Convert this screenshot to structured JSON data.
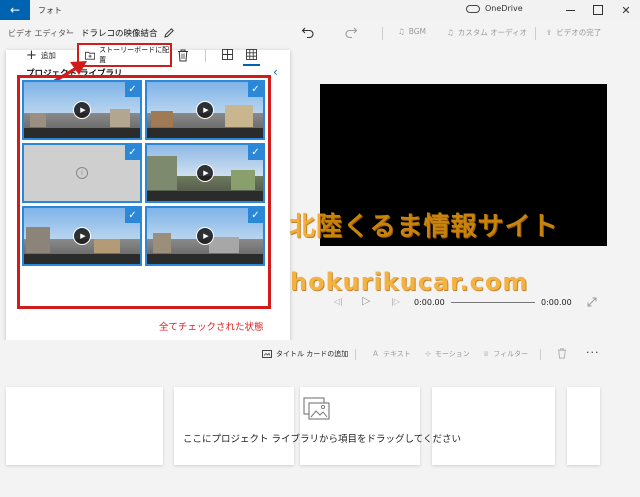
{
  "window": {
    "app_title": "フォト",
    "onedrive_label": "OneDrive",
    "back_icon": "back-arrow-icon",
    "min_icon": "minimize-icon",
    "max_icon": "maximize-icon",
    "close_icon": "close-icon"
  },
  "toolbar": {
    "breadcrumb_root": "ビデオ エディター",
    "breadcrumb_sep": "›",
    "project_name": "ドラレコの映像結合",
    "bgm_label": "BGM",
    "custom_audio_label": "カスタム オーディオ",
    "finish_video_label": "ビデオの完了"
  },
  "library": {
    "title": "プロジェクト ライブラリ",
    "collapse_glyph": "‹",
    "add_label": "追加",
    "add_glyph": "+",
    "storyboard_button_label": "ストーリーボードに配置",
    "clips": [
      {
        "kind": "video",
        "checked": true
      },
      {
        "kind": "video",
        "checked": true
      },
      {
        "kind": "unavailable",
        "checked": true
      },
      {
        "kind": "video",
        "checked": true
      },
      {
        "kind": "video",
        "checked": true
      },
      {
        "kind": "video",
        "checked": true
      }
    ],
    "play_glyph": "▶",
    "check_glyph": "✓",
    "info_glyph": "i"
  },
  "annotation": {
    "caption": "全てチェックされた状態",
    "highlight_color": "#d11c1c"
  },
  "watermark": {
    "line1": "北陸くるま情報サイト",
    "line2": "hokurikucar.com"
  },
  "preview": {
    "time_current": "0:00.00",
    "time_total": "0:00.00",
    "prev_glyph": "◁|",
    "play_glyph": "▷",
    "next_glyph": "|▷",
    "progress": 0
  },
  "storyboard": {
    "title_card_label": "タイトル カードの追加",
    "text_label": "テキスト",
    "motion_label": "モーション",
    "filter_label": "フィルター",
    "more_glyph": "···",
    "drop_hint": "ここにプロジェクト ライブラリから項目をドラッグしてください"
  },
  "colors": {
    "accent": "#0063b1",
    "selection": "#2b88d8",
    "highlight": "#d11c1c",
    "caption_red": "#e02020",
    "watermark_orange": "#f5a00f"
  }
}
